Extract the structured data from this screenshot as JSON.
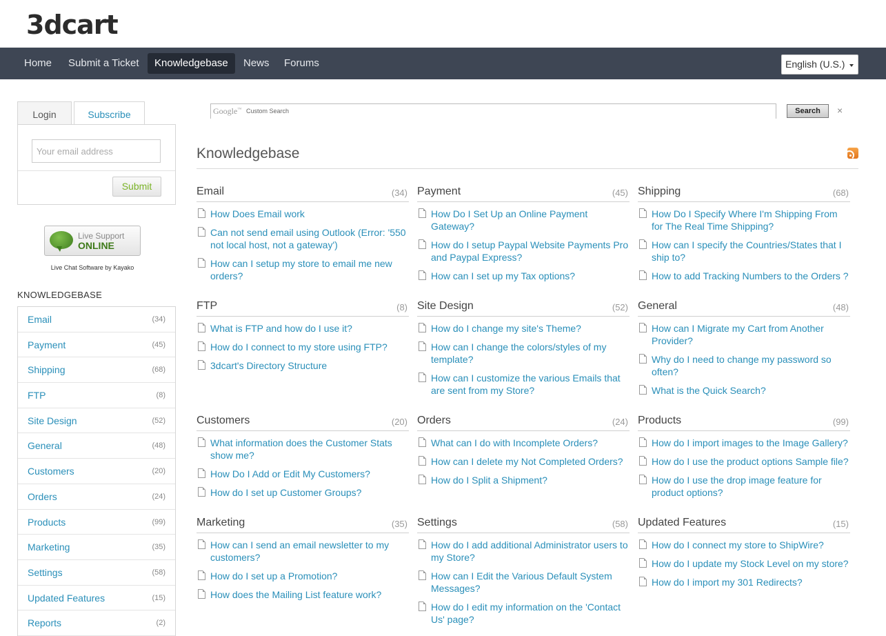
{
  "brand": {
    "logo_text": "3dcart"
  },
  "nav": {
    "items": [
      "Home",
      "Submit a Ticket",
      "Knowledgebase",
      "News",
      "Forums"
    ],
    "active": "Knowledgebase",
    "language": "English (U.S.)"
  },
  "sidebar": {
    "tabs": [
      "Login",
      "Subscribe"
    ],
    "active_tab": "Subscribe",
    "email_placeholder": "Your email address",
    "submit_label": "Submit",
    "live_support": {
      "line1": "Live Support",
      "line2": "ONLINE",
      "caption": "Live Chat Software by Kayako"
    },
    "kb_heading": "KNOWLEDGEBASE",
    "kb_items": [
      {
        "label": "Email",
        "count": "(34)"
      },
      {
        "label": "Payment",
        "count": "(45)"
      },
      {
        "label": "Shipping",
        "count": "(68)"
      },
      {
        "label": "FTP",
        "count": "(8)"
      },
      {
        "label": "Site Design",
        "count": "(52)"
      },
      {
        "label": "General",
        "count": "(48)"
      },
      {
        "label": "Customers",
        "count": "(20)"
      },
      {
        "label": "Orders",
        "count": "(24)"
      },
      {
        "label": "Products",
        "count": "(99)"
      },
      {
        "label": "Marketing",
        "count": "(35)"
      },
      {
        "label": "Settings",
        "count": "(58)"
      },
      {
        "label": "Updated Features",
        "count": "(15)"
      },
      {
        "label": "Reports",
        "count": "(2)"
      }
    ]
  },
  "search": {
    "google_label": "Google",
    "custom_label": "Custom Search",
    "button_label": "Search",
    "clear_label": "×"
  },
  "main": {
    "title": "Knowledgebase",
    "categories": [
      {
        "name": "Email",
        "count": "(34)",
        "articles": [
          "How Does Email work",
          "Can not send email using Outlook (Error: '550 not local host, not a gateway')",
          "How can I setup my store to email me new orders?"
        ]
      },
      {
        "name": "Payment",
        "count": "(45)",
        "articles": [
          "How Do I Set Up an Online Payment Gateway?",
          "How do I setup Paypal Website Payments Pro and Paypal Express?",
          "How can I set up my Tax options?"
        ]
      },
      {
        "name": "Shipping",
        "count": "(68)",
        "articles": [
          "How Do I Specify Where I'm Shipping From for The Real Time Shipping?",
          "How can I specify the Countries/States that I ship to?",
          "How to add Tracking Numbers to the Orders ?"
        ]
      },
      {
        "name": "FTP",
        "count": "(8)",
        "articles": [
          "What is FTP and how do I use it?",
          "How do I connect to my store using FTP?",
          "3dcart's Directory Structure"
        ]
      },
      {
        "name": "Site Design",
        "count": "(52)",
        "articles": [
          "How do I change my site's Theme?",
          "How can I change the colors/styles of my template?",
          "How can I customize the various Emails that are sent from my Store?"
        ]
      },
      {
        "name": "General",
        "count": "(48)",
        "articles": [
          "How can I Migrate my Cart from Another Provider?",
          "Why do I need to change my password so often?",
          "What is the Quick Search?"
        ]
      },
      {
        "name": "Customers",
        "count": "(20)",
        "articles": [
          "What information does the Customer Stats show me?",
          "How Do I Add or Edit My Customers?",
          "How do I set up Customer Groups?"
        ]
      },
      {
        "name": "Orders",
        "count": "(24)",
        "articles": [
          "What can I do with Incomplete Orders?",
          "How can I delete my Not Completed Orders?",
          "How do I Split a Shipment?"
        ]
      },
      {
        "name": "Products",
        "count": "(99)",
        "articles": [
          "How do I import images to the Image Gallery?",
          "How do I use the product options Sample file?",
          "How do I use the drop image feature for product options?"
        ]
      },
      {
        "name": "Marketing",
        "count": "(35)",
        "articles": [
          "How can I send an email newsletter to my customers?",
          "How do I set up a Promotion?",
          "How does the Mailing List feature work?"
        ]
      },
      {
        "name": "Settings",
        "count": "(58)",
        "articles": [
          "How do I add additional Administrator users to my Store?",
          "How can I Edit the Various Default System Messages?",
          "How do I edit my information on the 'Contact Us' page?"
        ]
      },
      {
        "name": "Updated Features",
        "count": "(15)",
        "articles": [
          "How do I connect my store to ShipWire?",
          "How do I update my Stock Level on my store?",
          "How do I import my 301 Redirects?"
        ]
      }
    ]
  }
}
